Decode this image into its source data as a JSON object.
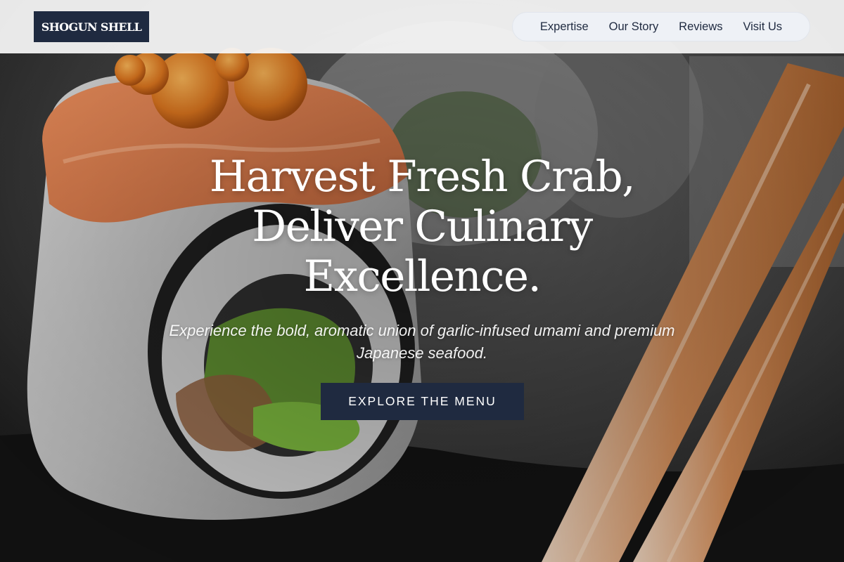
{
  "brand": {
    "logo_text": "SHOGUN SHELL"
  },
  "nav": {
    "items": [
      {
        "label": "Expertise"
      },
      {
        "label": "Our Story"
      },
      {
        "label": "Reviews"
      },
      {
        "label": "Visit Us"
      }
    ]
  },
  "hero": {
    "headline_lines": [
      "Harvest Fresh Crab,",
      "Deliver Culinary",
      "Excellence."
    ],
    "subtitle_lines": [
      "Experience the bold, aromatic union of garlic-infused umami and premium",
      "Japanese seafood."
    ],
    "cta_label": "EXPLORE THE MENU",
    "background_image": "sushi-roll-with-chopsticks-photo"
  },
  "colors": {
    "brand_navy": "#1f2a40",
    "header_bg": "#f8f8f8",
    "nav_pill_bg": "#eef1f6",
    "text_light": "#ffffff"
  }
}
